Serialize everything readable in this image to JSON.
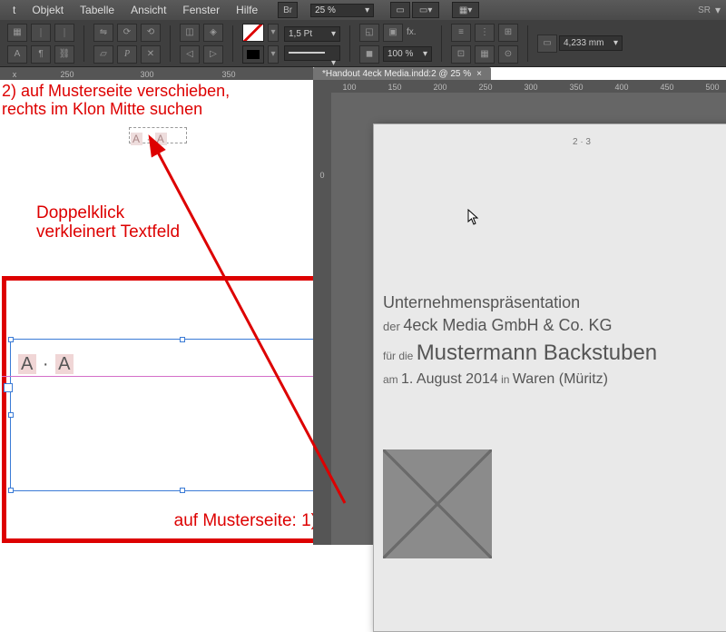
{
  "menu": {
    "items": [
      "t",
      "Objekt",
      "Tabelle",
      "Ansicht",
      "Fenster",
      "Hilfe"
    ],
    "br_label": "Br",
    "zoom": "25 %",
    "sr_label": "SR"
  },
  "controlbar": {
    "stroke_weight": "1,5 Pt",
    "opacity": "100 %",
    "fx_label": "fx.",
    "w_value": "4,233 mm"
  },
  "tab": {
    "title": "*Handout 4eck Media.indd:2 @ 25 %",
    "close": "×"
  },
  "left_ruler": {
    "cap": "x",
    "labels": [
      "250",
      "300",
      "350"
    ]
  },
  "right_ruler_top": {
    "labels": [
      "100",
      "150",
      "200",
      "250",
      "300",
      "350",
      "400",
      "450",
      "500"
    ]
  },
  "right_ruler_left": {
    "labels": [
      "0"
    ]
  },
  "left_panel": {
    "annot1": "2) auf Musterseite verschieben, rechts im Klon Mitte suchen",
    "annot2_line1": "Doppelklick",
    "annot2_line2": "verkleinert Textfeld",
    "annot3": "auf Musterseite: 1)",
    "folio_sm_a": "A",
    "folio_sm_dot": "·",
    "folio_sm_b": "A",
    "folio_big_a": "A",
    "folio_big_dot": "·",
    "folio_big_b": "A"
  },
  "right_page": {
    "folio": "2 · 3",
    "line1": "Unternehmenspräsentation",
    "line2_pre": "der ",
    "line2_main": "4eck Media GmbH & Co. KG",
    "line3_pre": "für die ",
    "line3_main": "Mustermann Backstuben",
    "line4_pre": "am ",
    "line4_date": "1. August 2014",
    "line4_mid": " in ",
    "line4_loc": "Waren (Müritz)"
  }
}
